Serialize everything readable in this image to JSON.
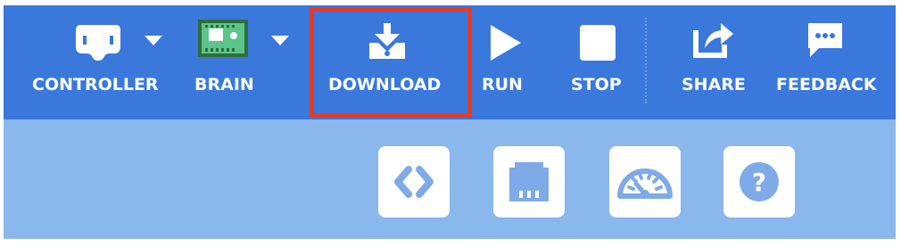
{
  "toolbar": {
    "controller_label": "CONTROLLER",
    "brain_label": "BRAIN",
    "download_label": "DOWNLOAD",
    "run_label": "RUN",
    "stop_label": "STOP",
    "share_label": "SHARE",
    "feedback_label": "FEEDBACK"
  },
  "tools": {
    "help_symbol": "?"
  },
  "colors": {
    "toolbar_bg": "#3a78dc",
    "subbar_bg": "#8ab7ec",
    "highlight": "#e63a26",
    "brain_green": "#5bc58a",
    "icon_blue": "#7eaae8"
  }
}
